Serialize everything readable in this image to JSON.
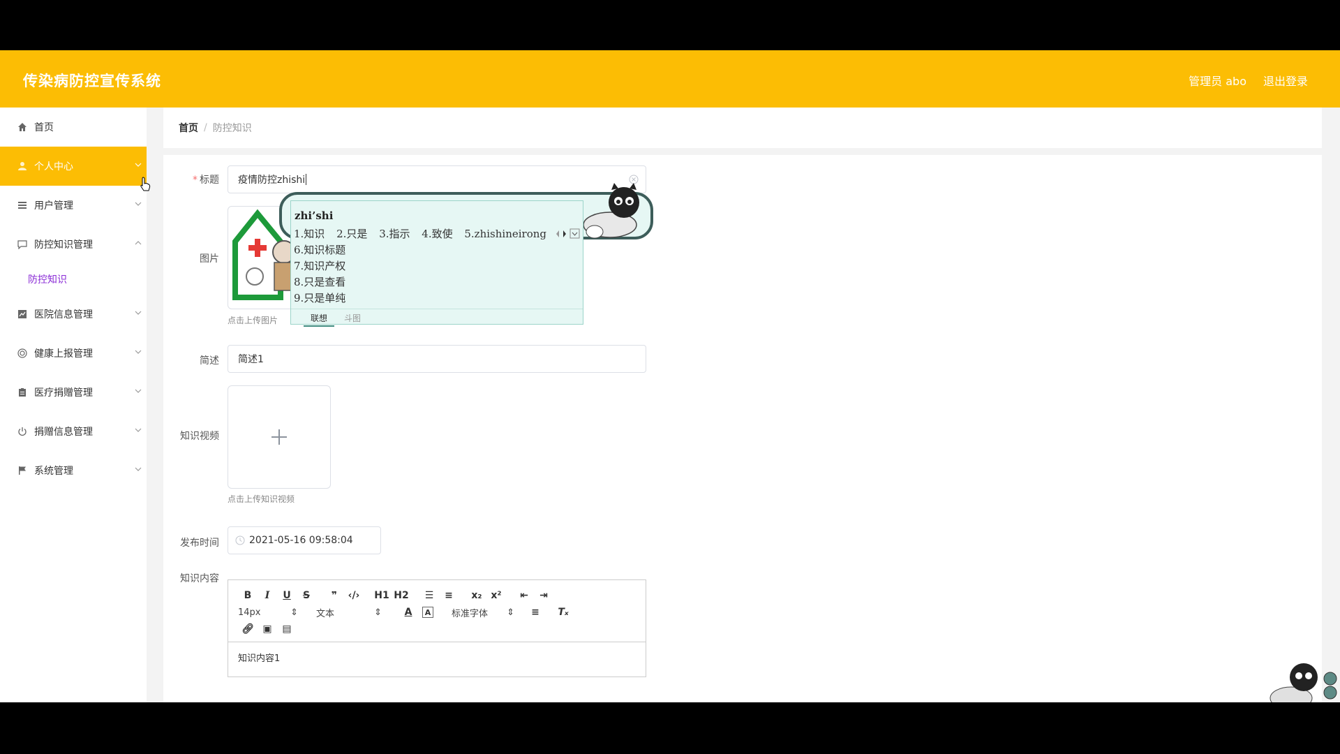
{
  "app": {
    "title": "传染病防控宣传系统",
    "user_label": "管理员 abo",
    "logout_label": "退出登录",
    "accent_color": "#fcbd04"
  },
  "sidebar": {
    "items": [
      {
        "label": "首页",
        "icon": "home-icon"
      },
      {
        "label": "个人中心",
        "icon": "user-icon",
        "active": true
      },
      {
        "label": "用户管理",
        "icon": "list-icon"
      },
      {
        "label": "防控知识管理",
        "icon": "chat-icon",
        "expanded": true
      },
      {
        "label": "医院信息管理",
        "icon": "chart-icon"
      },
      {
        "label": "健康上报管理",
        "icon": "lifebuoy-icon"
      },
      {
        "label": "医疗捐赠管理",
        "icon": "clipboard-icon"
      },
      {
        "label": "捐赠信息管理",
        "icon": "power-icon"
      },
      {
        "label": "系统管理",
        "icon": "flag-icon"
      }
    ],
    "sub_item": "防控知识"
  },
  "breadcrumb": {
    "home": "首页",
    "separator": "/",
    "current": "防控知识"
  },
  "form": {
    "title_label": "标题",
    "required_mark": "*",
    "title_value": "疫情防控zhishi",
    "image_label": "图片",
    "image_hint": "点击上传图片",
    "summary_label": "简述",
    "summary_value": "简述1",
    "video_label": "知识视频",
    "video_hint": "点击上传知识视频",
    "publish_label": "发布时间",
    "publish_value": "2021-05-16 09:58:04",
    "content_label": "知识内容",
    "content_value": "知识内容1"
  },
  "editor": {
    "font_size": "14px",
    "paragraph": "文本",
    "font_family": "标准字体",
    "h1": "H1",
    "h2": "H2"
  },
  "ime": {
    "pinyin": "zhi’shi",
    "candidates_row1": [
      "1.知识",
      "2.只是",
      "3.指示",
      "4.致使",
      "5.zhishineirong"
    ],
    "candidates_more": [
      "6.知识标题",
      "7.知识产权",
      "8.只是查看",
      "9.只是单纯"
    ],
    "tab_active": "联想",
    "tab_other": "斗图"
  }
}
